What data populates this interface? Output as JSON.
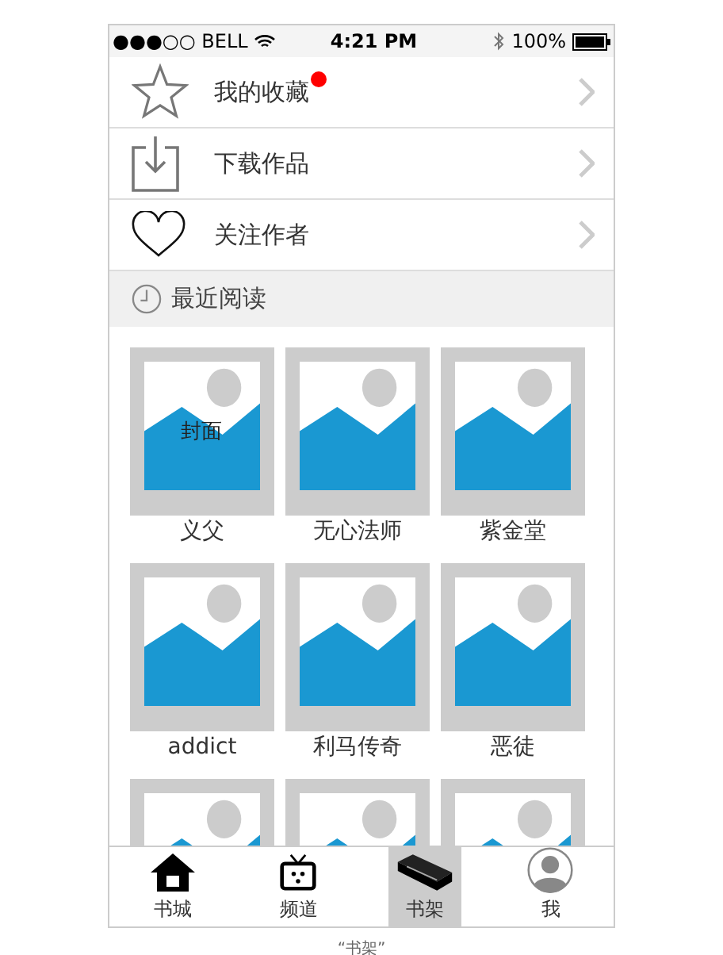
{
  "status_bar": {
    "carrier": "●●●○○ BELL",
    "time": "4:21 PM",
    "battery": "100%"
  },
  "menu": [
    {
      "kind": "star",
      "label": "我的收藏",
      "badge": true
    },
    {
      "kind": "download",
      "label": "下载作品",
      "badge": false
    },
    {
      "kind": "heart",
      "label": "关注作者",
      "badge": false
    }
  ],
  "recent": {
    "title": "最近阅读"
  },
  "books": [
    {
      "kind": "picture",
      "title": "义父",
      "cover_label": "封面"
    },
    {
      "kind": "picture",
      "title": "无心法师"
    },
    {
      "kind": "picture",
      "title": "紫金堂"
    },
    {
      "kind": "picture",
      "title": "addict"
    },
    {
      "kind": "picture",
      "title": "利马传奇"
    },
    {
      "kind": "picture",
      "title": "恶徒"
    },
    {
      "kind": "picture"
    },
    {
      "kind": "picture"
    },
    {
      "kind": "picture"
    }
  ],
  "tabs": [
    {
      "kind": "home",
      "label": "书城",
      "selected": false
    },
    {
      "kind": "tv",
      "label": "频道",
      "selected": false
    },
    {
      "kind": "shelf",
      "label": "书架",
      "selected": true
    },
    {
      "kind": "me",
      "label": "我",
      "selected": false
    }
  ],
  "caption": "“书架”"
}
